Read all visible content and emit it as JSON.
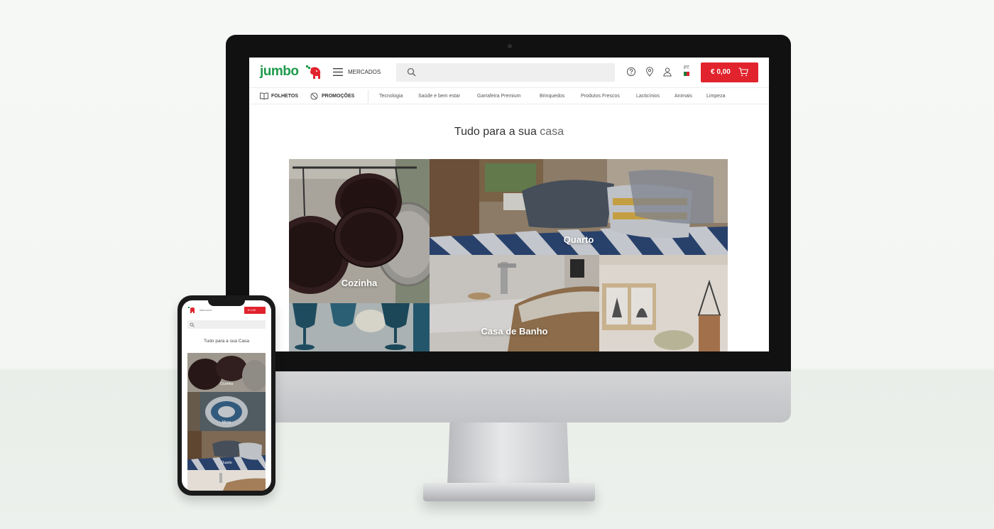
{
  "desktop": {
    "header": {
      "logo_text": "jumbo",
      "menu_label": "MERCADOS",
      "search_placeholder": "",
      "language_code": "PT",
      "cart_total": "€ 0,00"
    },
    "nav": {
      "brochures": "FOLHETOS",
      "promotions": "PROMOÇÕES",
      "categories": [
        "Tecnologia",
        "Saúde e bem estar",
        "Garrafeira Premium",
        "Brinquedos",
        "Produtos Frescos",
        "Lacticínios",
        "Animais",
        "Limpeza"
      ]
    },
    "headline": {
      "main": "Tudo para a sua",
      "accent": "casa"
    },
    "tiles": {
      "cozinha": "Cozinha",
      "quarto": "Quarto",
      "casa_de_banho": "Casa de Banho"
    }
  },
  "mobile": {
    "headline": "Tudo para a sua Casa",
    "tiles": [
      "Cozinha",
      "Mesa",
      "Quarto"
    ],
    "cart_total": "€ 0,00"
  },
  "colors": {
    "brand_green": "#1f9a4b",
    "brand_red": "#e1232d"
  }
}
